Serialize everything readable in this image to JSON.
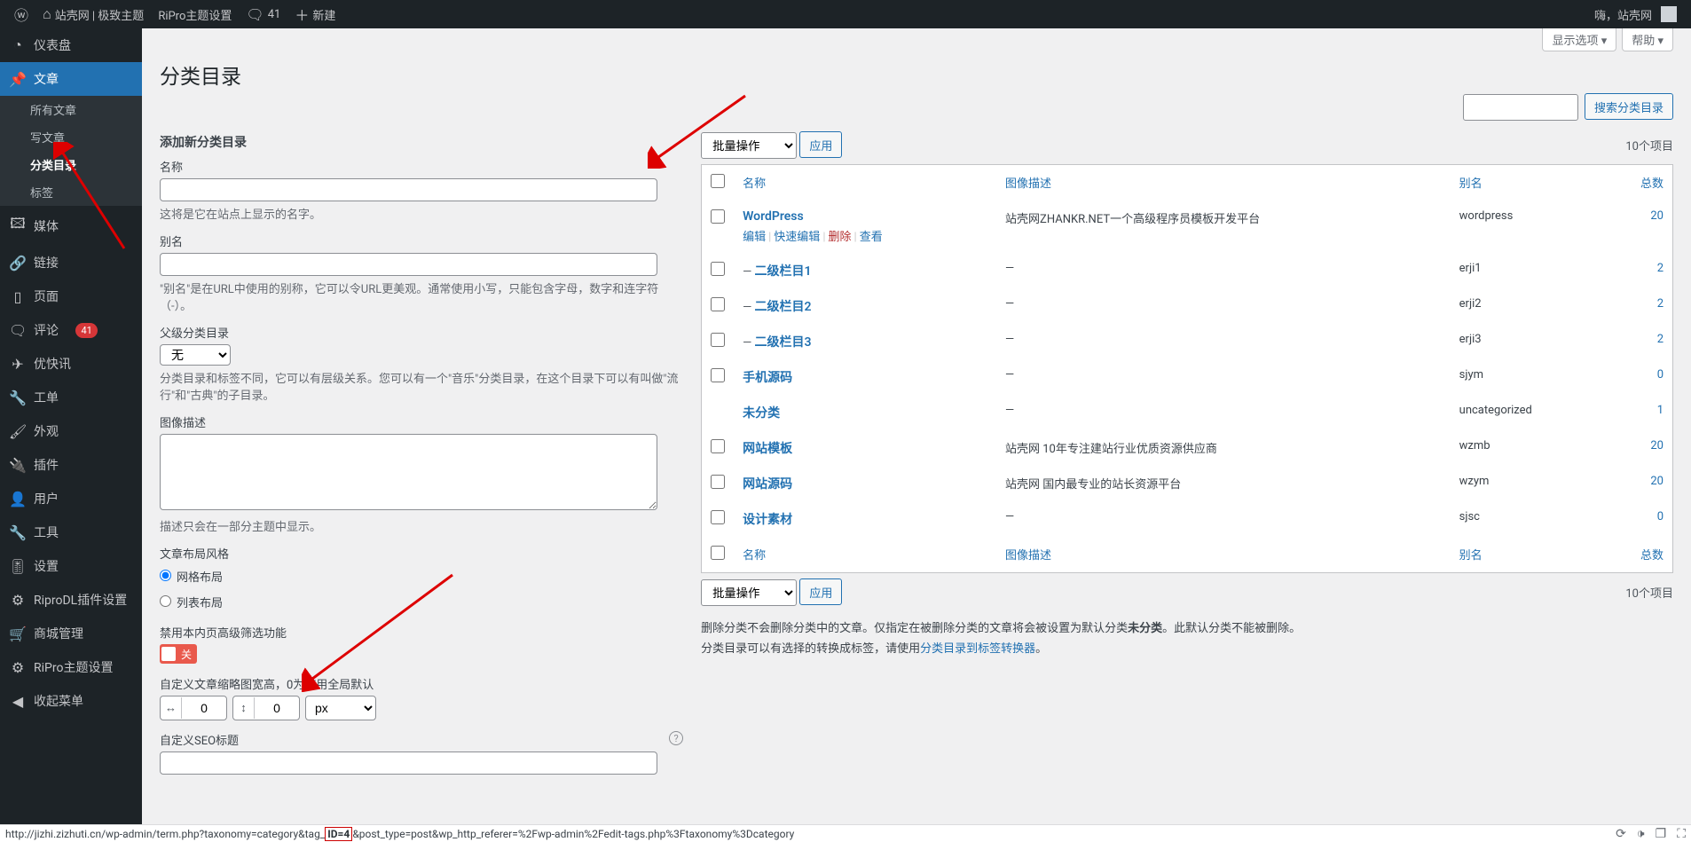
{
  "adminbar": {
    "site_name": "站壳网 | 极致主题",
    "ripro": "RiPro主题设置",
    "comments_count": "41",
    "new": "新建",
    "howdy": "嗨，站壳网"
  },
  "menu": {
    "dashboard": "仪表盘",
    "posts": "文章",
    "posts_sub": {
      "all": "所有文章",
      "new": "写文章",
      "categories": "分类目录",
      "tags": "标签"
    },
    "media": "媒体",
    "links": "链接",
    "pages": "页面",
    "comments": "评论",
    "comments_count": "41",
    "news": "优快讯",
    "tickets": "工单",
    "appearance": "外观",
    "plugins": "插件",
    "users": "用户",
    "tools": "工具",
    "settings": "设置",
    "riprodl": "RiproDL插件设置",
    "shop": "商城管理",
    "ripro_theme": "RiPro主题设置",
    "collapse": "收起菜单"
  },
  "screen_meta": {
    "options": "显示选项",
    "help": "帮助"
  },
  "page": {
    "title": "分类目录"
  },
  "search": {
    "placeholder": "",
    "button": "搜索分类目录"
  },
  "form": {
    "heading": "添加新分类目录",
    "name_label": "名称",
    "name_desc": "这将是它在站点上显示的名字。",
    "slug_label": "别名",
    "slug_desc": "\"别名\"是在URL中使用的别称，它可以令URL更美观。通常使用小写，只能包含字母，数字和连字符（-）。",
    "parent_label": "父级分类目录",
    "parent_none": "无",
    "parent_desc": "分类目录和标签不同，它可以有层级关系。您可以有一个\"音乐\"分类目录，在这个目录下可以有叫做\"流行\"和\"古典\"的子目录。",
    "imgdesc_label": "图像描述",
    "imgdesc_desc": "描述只会在一部分主题中显示。",
    "layout_label": "文章布局风格",
    "layout_options": [
      "网格布局",
      "列表布局"
    ],
    "disable_filter": "禁用本内页高级筛选功能",
    "disable_filter_state": "关",
    "thumb_label": "自定义文章缩略图宽高，0为使用全局默认",
    "thumb_w": "0",
    "thumb_h": "0",
    "thumb_unit": "px",
    "seo_title_label": "自定义SEO标题"
  },
  "bulk": {
    "label": "批量操作",
    "apply": "应用",
    "count": "10个项目"
  },
  "table": {
    "cols": {
      "name": "名称",
      "imgdesc": "图像描述",
      "slug": "别名",
      "count": "总数"
    },
    "row_actions": {
      "edit": "编辑",
      "quick": "快速编辑",
      "delete": "删除",
      "view": "查看"
    },
    "rows": [
      {
        "name": "WordPress",
        "desc": "站壳网ZHANKR.NET一个高级程序员模板开发平台",
        "slug": "wordpress",
        "count": "20",
        "show_actions": true,
        "depth": 0
      },
      {
        "name": "二级栏目1",
        "desc": "—",
        "slug": "erji1",
        "count": "2",
        "depth": 1
      },
      {
        "name": "二级栏目2",
        "desc": "—",
        "slug": "erji2",
        "count": "2",
        "depth": 1
      },
      {
        "name": "二级栏目3",
        "desc": "—",
        "slug": "erji3",
        "count": "2",
        "depth": 1
      },
      {
        "name": "手机源码",
        "desc": "—",
        "slug": "sjym",
        "count": "0",
        "depth": 0,
        "name_bold": true
      },
      {
        "name": "未分类",
        "desc": "—",
        "slug": "uncategorized",
        "count": "1",
        "depth": 0,
        "no_cb": true,
        "name_bold": true
      },
      {
        "name": "网站模板",
        "desc": "站壳网 10年专注建站行业优质资源供应商",
        "slug": "wzmb",
        "count": "20",
        "depth": 0,
        "name_bold": true
      },
      {
        "name": "网站源码",
        "desc": "站壳网 国内最专业的站长资源平台",
        "slug": "wzym",
        "count": "20",
        "depth": 0,
        "name_bold": true
      },
      {
        "name": "设计素材",
        "desc": "—",
        "slug": "sjsc",
        "count": "0",
        "depth": 0,
        "name_bold": true
      }
    ]
  },
  "notes": {
    "p1a": "删除分类不会删除分类中的文章。仅指定在被删除分类的文章将会被设置为默认分类",
    "p1b": "未分类",
    "p1c": "。此默认分类不能被删除。",
    "p2a": "分类目录可以有选择的转换成标签，请使用",
    "p2link": "分类目录到标签转换器",
    "p2b": "。"
  },
  "status": {
    "url_pre": "http://jizhi.zizhuti.cn/wp-admin/term.php?taxonomy=category&tag_",
    "url_box": "ID=4",
    "url_post": "&post_type=post&wp_http_referer=%2Fwp-admin%2Fedit-tags.php%3Ftaxonomy%3Dcategory"
  }
}
